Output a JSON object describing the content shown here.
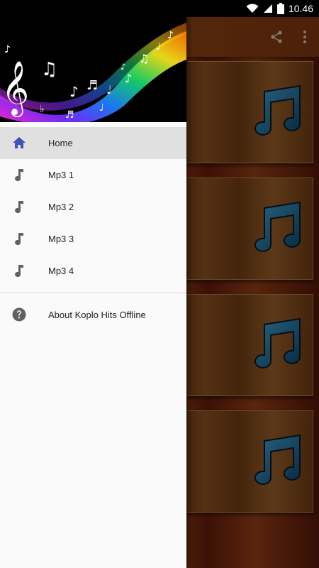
{
  "status_bar": {
    "time": "10.46",
    "icons": [
      "wifi-icon",
      "signal-icon",
      "battery-icon"
    ]
  },
  "app_bar": {
    "actions": [
      "share-icon",
      "overflow-menu-icon"
    ]
  },
  "list_cards": [
    {
      "icon": "music-note-icon"
    },
    {
      "icon": "music-note-icon"
    },
    {
      "icon": "music-note-icon"
    },
    {
      "icon": "music-note-icon"
    }
  ],
  "drawer": {
    "header_image": "music-notes-rainbow-banner",
    "items": [
      {
        "label": "Home",
        "icon": "home-icon",
        "active": true
      },
      {
        "label": "Mp3 1",
        "icon": "music-note-icon"
      },
      {
        "label": "Mp3 2",
        "icon": "music-note-icon"
      },
      {
        "label": "Mp3 3",
        "icon": "music-note-icon"
      },
      {
        "label": "Mp3 4",
        "icon": "music-note-icon"
      }
    ],
    "secondary_items": [
      {
        "label": "About Koplo Hits Offline",
        "icon": "help-icon"
      }
    ]
  },
  "colors": {
    "accent": "#3f51b5",
    "drawer_bg": "#fafafa",
    "active_row": "#e0e0e0",
    "icon_gray": "#616161"
  }
}
